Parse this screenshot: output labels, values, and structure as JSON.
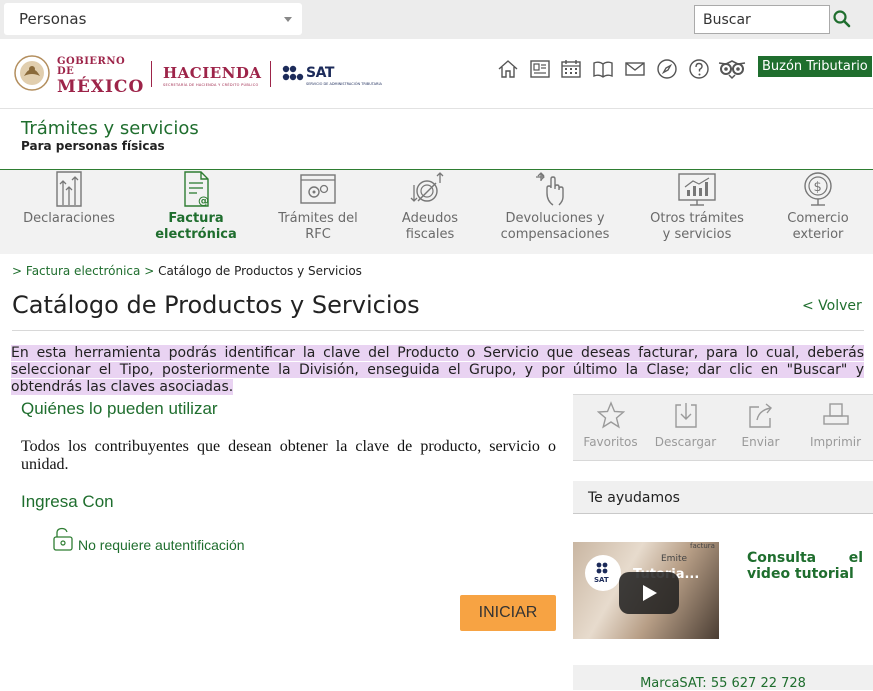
{
  "topbar": {
    "persona_select": "Personas",
    "search_placeholder": "Buscar"
  },
  "header": {
    "gob_line1": "GOBIERNO DE",
    "gob_line2": "MÉXICO",
    "hacienda": "HACIENDA",
    "hacienda_sub": "SECRETARÍA DE HACIENDA Y CRÉDITO PÚBLICO",
    "sat": "SAT",
    "sat_sub": "SERVICIO DE ADMINISTRACIÓN TRIBUTARIA",
    "icons": [
      "home-icon",
      "news-icon",
      "calendar-icon",
      "book-icon",
      "mail-icon",
      "compass-icon",
      "help-icon",
      "accessibility-icon"
    ],
    "buzon": "Buzón Tributario"
  },
  "section": {
    "title": "Trámites y servicios",
    "subtitle": "Para personas físicas"
  },
  "category_nav": [
    {
      "line1": "Declaraciones",
      "line2": "",
      "active": false
    },
    {
      "line1": "Factura",
      "line2": "electrónica",
      "active": true
    },
    {
      "line1": "Trámites del",
      "line2": "RFC",
      "active": false
    },
    {
      "line1": "Adeudos",
      "line2": "fiscales",
      "active": false
    },
    {
      "line1": "Devoluciones y",
      "line2": "compensaciones",
      "active": false
    },
    {
      "line1": "Otros trámites",
      "line2": "y servicios",
      "active": false
    },
    {
      "line1": "Comercio",
      "line2": "exterior",
      "active": false
    }
  ],
  "breadcrumb": {
    "sep1": ">",
    "link": "Factura electrónica",
    "sep2": ">",
    "current": "Catálogo de Productos y Servicios"
  },
  "page": {
    "title": "Catálogo de Productos y Servicios",
    "back": "< Volver",
    "intro": "En esta herramienta podrás identificar la clave del Producto o Servicio que deseas facturar, para lo cual, deberás seleccionar el Tipo, posteriormente la División, enseguida el Grupo, y por último la Clase; dar clic en \"Buscar\" y obtendrás las claves asociadas."
  },
  "main": {
    "who_heading": "Quiénes lo pueden utilizar",
    "who_text": "Todos los contribuyentes que desean obtener la clave de producto, servicio o unidad.",
    "ingresa_heading": "Ingresa Con",
    "auth_text": "No requiere autentificación",
    "start_button": "INICIAR"
  },
  "sidebar": {
    "actions": [
      {
        "icon": "star-icon",
        "label": "Favoritos"
      },
      {
        "icon": "download-icon",
        "label": "Descargar"
      },
      {
        "icon": "share-icon",
        "label": "Enviar"
      },
      {
        "icon": "print-icon",
        "label": "Imprimir"
      }
    ],
    "help_title": "Te ayudamos",
    "video_caption_top": "Emite",
    "video_caption_sub": "factura",
    "video_title": "Tutoria...",
    "video_link": "Consulta el video tutorial",
    "marca": "MarcaSAT: 55 627 22 728"
  }
}
